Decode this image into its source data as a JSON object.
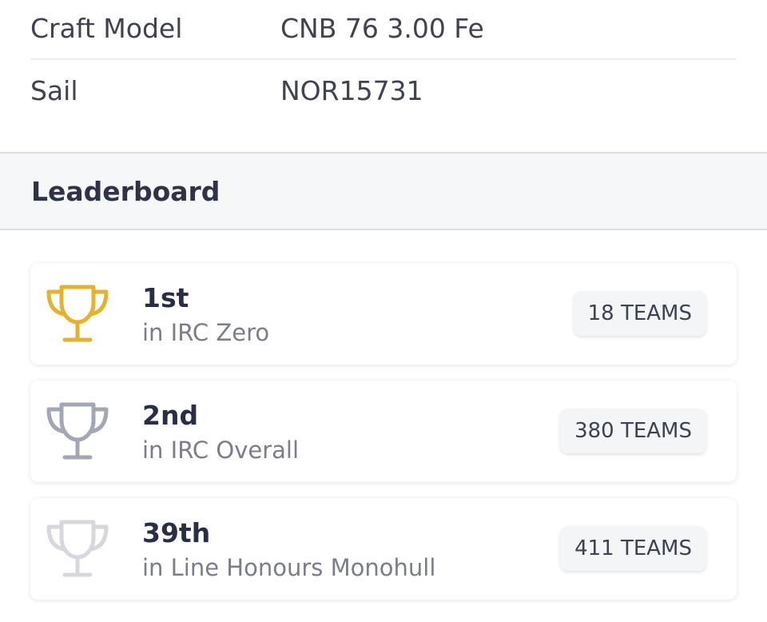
{
  "details": {
    "craft_model_label": "Craft Model",
    "craft_model_value": "CNB 76 3.00 Fe",
    "sail_label": "Sail",
    "sail_value": "NOR15731"
  },
  "leaderboard": {
    "title": "Leaderboard",
    "entries": [
      {
        "rank": "1st",
        "division": "in IRC Zero",
        "teams": "18 TEAMS",
        "icon": "trophy-gold-icon",
        "color": "#e5b22d"
      },
      {
        "rank": "2nd",
        "division": "in IRC Overall",
        "teams": "380 TEAMS",
        "icon": "trophy-silver-icon",
        "color": "#a3a7b3"
      },
      {
        "rank": "39th",
        "division": "in Line Honours Monohull",
        "teams": "411 TEAMS",
        "icon": "trophy-outline-icon",
        "color": "#d6d8de"
      }
    ]
  }
}
